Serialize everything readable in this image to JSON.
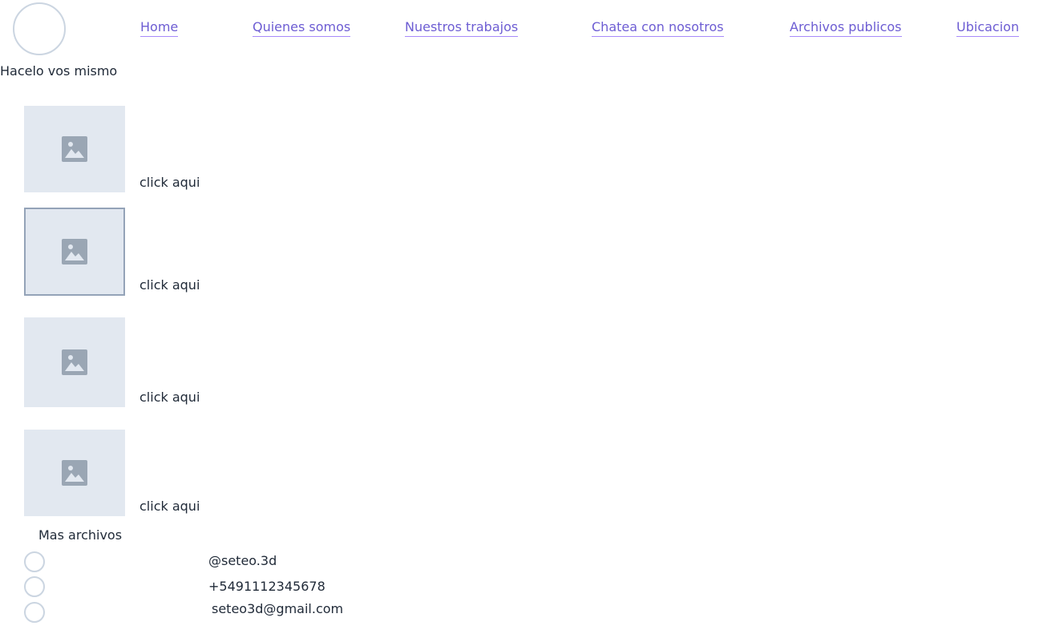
{
  "header": {
    "tagline": "Hacelo vos mismo",
    "nav": [
      {
        "label": "Home"
      },
      {
        "label": "Quienes somos"
      },
      {
        "label": "Nuestros trabajos"
      },
      {
        "label": "Chatea con nosotros"
      },
      {
        "label": "Archivos publicos"
      },
      {
        "label": "Ubicacion"
      }
    ],
    "link_color": "#6d5dd3"
  },
  "files": {
    "items": [
      {
        "label": "click aqui",
        "icon": "image-placeholder-icon"
      },
      {
        "label": "click aqui",
        "icon": "image-placeholder-icon",
        "selected": true
      },
      {
        "label": "click aqui",
        "icon": "image-placeholder-icon"
      },
      {
        "label": "click aqui",
        "icon": "image-placeholder-icon"
      }
    ],
    "more_label": "Mas archivos"
  },
  "contact": {
    "items": [
      {
        "text": "@seteo.3d",
        "icon": "instagram-icon"
      },
      {
        "text": "+5491112345678",
        "icon": "phone-icon"
      },
      {
        "text": "seteo3d@gmail.com",
        "icon": "email-icon"
      }
    ]
  },
  "colors": {
    "placeholder_bg": "#e2e8f0",
    "placeholder_icon": "#9aa6b4",
    "circle_border": "#cbd5e1"
  }
}
